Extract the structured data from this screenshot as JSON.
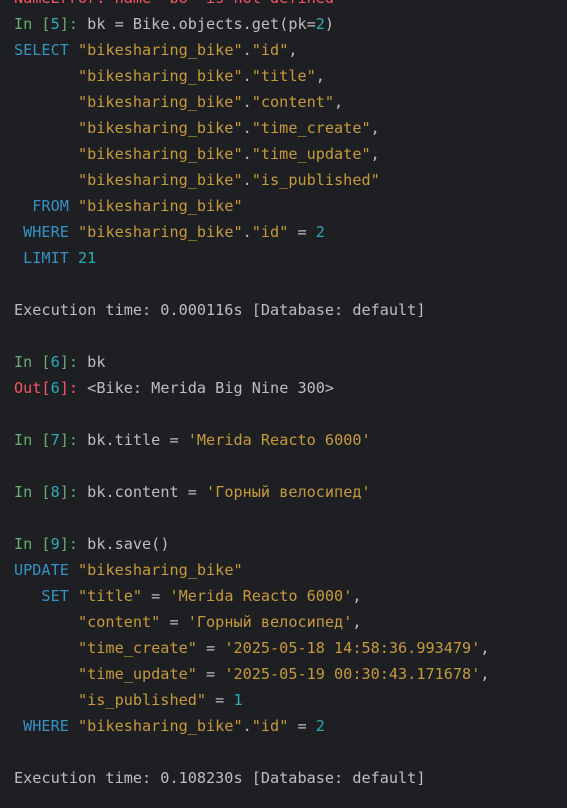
{
  "colors": {
    "background": "#1e1f22",
    "plain": "#bcbec4",
    "error": "#f75464",
    "in_prompt": "#6aab73",
    "number": "#2aacb8",
    "out_prompt": "#f75464",
    "sql_keyword": "#3592c4",
    "string": "#c69a3a"
  },
  "lines": [
    [
      {
        "t": "NameError: name 'bo' is not defined",
        "c": "err"
      }
    ],
    [
      {
        "t": "In [",
        "c": "in"
      },
      {
        "t": "5",
        "c": "num"
      },
      {
        "t": "]: ",
        "c": "in"
      },
      {
        "t": "bk = Bike.objects.get(pk=",
        "c": "plain"
      },
      {
        "t": "2",
        "c": "num"
      },
      {
        "t": ")",
        "c": "plain"
      }
    ],
    [
      {
        "t": "SELECT ",
        "c": "kw"
      },
      {
        "t": "\"bikesharing_bike\"",
        "c": "str"
      },
      {
        "t": ".",
        "c": "plain"
      },
      {
        "t": "\"id\"",
        "c": "str"
      },
      {
        "t": ",",
        "c": "plain"
      }
    ],
    [
      {
        "t": "       \"bikesharing_bike\"",
        "c": "str"
      },
      {
        "t": ".",
        "c": "plain"
      },
      {
        "t": "\"title\"",
        "c": "str"
      },
      {
        "t": ",",
        "c": "plain"
      }
    ],
    [
      {
        "t": "       \"bikesharing_bike\"",
        "c": "str"
      },
      {
        "t": ".",
        "c": "plain"
      },
      {
        "t": "\"content\"",
        "c": "str"
      },
      {
        "t": ",",
        "c": "plain"
      }
    ],
    [
      {
        "t": "       \"bikesharing_bike\"",
        "c": "str"
      },
      {
        "t": ".",
        "c": "plain"
      },
      {
        "t": "\"time_create\"",
        "c": "str"
      },
      {
        "t": ",",
        "c": "plain"
      }
    ],
    [
      {
        "t": "       \"bikesharing_bike\"",
        "c": "str"
      },
      {
        "t": ".",
        "c": "plain"
      },
      {
        "t": "\"time_update\"",
        "c": "str"
      },
      {
        "t": ",",
        "c": "plain"
      }
    ],
    [
      {
        "t": "       \"bikesharing_bike\"",
        "c": "str"
      },
      {
        "t": ".",
        "c": "plain"
      },
      {
        "t": "\"is_published\"",
        "c": "str"
      }
    ],
    [
      {
        "t": "  FROM ",
        "c": "kw"
      },
      {
        "t": "\"bikesharing_bike\"",
        "c": "str"
      }
    ],
    [
      {
        "t": " WHERE ",
        "c": "kw"
      },
      {
        "t": "\"bikesharing_bike\"",
        "c": "str"
      },
      {
        "t": ".",
        "c": "plain"
      },
      {
        "t": "\"id\"",
        "c": "str"
      },
      {
        "t": " = ",
        "c": "plain"
      },
      {
        "t": "2",
        "c": "num"
      }
    ],
    [
      {
        "t": " LIMIT ",
        "c": "kw"
      },
      {
        "t": "21",
        "c": "num"
      }
    ],
    [],
    [
      {
        "t": "Execution time: 0.000116s [Database: default]",
        "c": "plain"
      }
    ],
    [],
    [
      {
        "t": "In [",
        "c": "in"
      },
      {
        "t": "6",
        "c": "num"
      },
      {
        "t": "]: ",
        "c": "in"
      },
      {
        "t": "bk",
        "c": "plain"
      }
    ],
    [
      {
        "t": "Out[",
        "c": "out"
      },
      {
        "t": "6",
        "c": "num"
      },
      {
        "t": "]: ",
        "c": "out"
      },
      {
        "t": "<Bike: Merida Big Nine 300>",
        "c": "plain"
      }
    ],
    [],
    [
      {
        "t": "In [",
        "c": "in"
      },
      {
        "t": "7",
        "c": "num"
      },
      {
        "t": "]: ",
        "c": "in"
      },
      {
        "t": "bk.title = ",
        "c": "plain"
      },
      {
        "t": "'Merida Reacto 6000'",
        "c": "str"
      }
    ],
    [],
    [
      {
        "t": "In [",
        "c": "in"
      },
      {
        "t": "8",
        "c": "num"
      },
      {
        "t": "]: ",
        "c": "in"
      },
      {
        "t": "bk.content = ",
        "c": "plain"
      },
      {
        "t": "'Горный велосипед'",
        "c": "str"
      }
    ],
    [],
    [
      {
        "t": "In [",
        "c": "in"
      },
      {
        "t": "9",
        "c": "num"
      },
      {
        "t": "]: ",
        "c": "in"
      },
      {
        "t": "bk.save()",
        "c": "plain"
      }
    ],
    [
      {
        "t": "UPDATE ",
        "c": "kw"
      },
      {
        "t": "\"bikesharing_bike\"",
        "c": "str"
      }
    ],
    [
      {
        "t": "   SET ",
        "c": "kw"
      },
      {
        "t": "\"title\"",
        "c": "str"
      },
      {
        "t": " = ",
        "c": "plain"
      },
      {
        "t": "'Merida Reacto 6000'",
        "c": "str"
      },
      {
        "t": ",",
        "c": "plain"
      }
    ],
    [
      {
        "t": "       \"content\"",
        "c": "str"
      },
      {
        "t": " = ",
        "c": "plain"
      },
      {
        "t": "'Горный велосипед'",
        "c": "str"
      },
      {
        "t": ",",
        "c": "plain"
      }
    ],
    [
      {
        "t": "       \"time_create\"",
        "c": "str"
      },
      {
        "t": " = ",
        "c": "plain"
      },
      {
        "t": "'2025-05-18 14:58:36.993479'",
        "c": "str"
      },
      {
        "t": ",",
        "c": "plain"
      }
    ],
    [
      {
        "t": "       \"time_update\"",
        "c": "str"
      },
      {
        "t": " = ",
        "c": "plain"
      },
      {
        "t": "'2025-05-19 00:30:43.171678'",
        "c": "str"
      },
      {
        "t": ",",
        "c": "plain"
      }
    ],
    [
      {
        "t": "       \"is_published\"",
        "c": "str"
      },
      {
        "t": " = ",
        "c": "plain"
      },
      {
        "t": "1",
        "c": "num"
      }
    ],
    [
      {
        "t": " WHERE ",
        "c": "kw"
      },
      {
        "t": "\"bikesharing_bike\"",
        "c": "str"
      },
      {
        "t": ".",
        "c": "plain"
      },
      {
        "t": "\"id\"",
        "c": "str"
      },
      {
        "t": " = ",
        "c": "plain"
      },
      {
        "t": "2",
        "c": "num"
      }
    ],
    [],
    [
      {
        "t": "Execution time: 0.108230s [Database: default]",
        "c": "plain"
      }
    ]
  ]
}
